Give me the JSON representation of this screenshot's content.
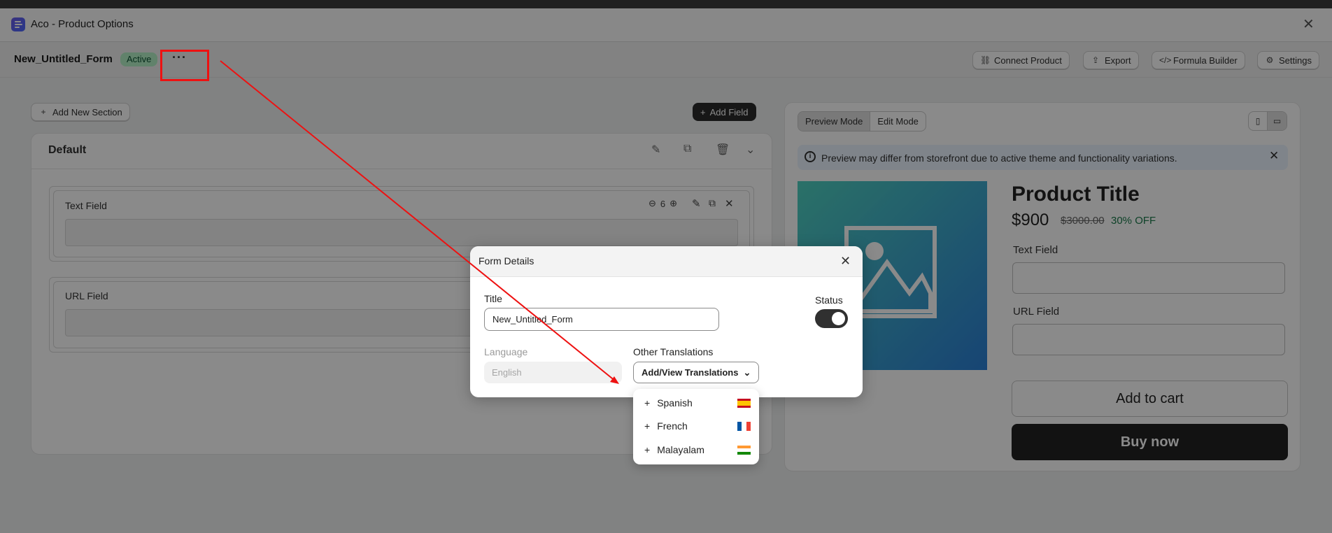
{
  "app": {
    "title": "Aco - Product Options"
  },
  "header": {
    "form_name": "New_Untitled_Form",
    "status_badge": "Active",
    "more_label": "···",
    "buttons": [
      {
        "label": "Connect Product",
        "icon": "link-icon"
      },
      {
        "label": "Export",
        "icon": "upload-icon"
      },
      {
        "label": "Formula Builder",
        "icon": "code-icon"
      },
      {
        "label": "Settings",
        "icon": "gear-icon"
      }
    ]
  },
  "builder": {
    "add_section_label": "Add New Section",
    "add_field_label": "Add Field",
    "section_title": "Default",
    "fields": [
      {
        "label": "Text Field",
        "width_value": "6"
      },
      {
        "label": "URL Field"
      }
    ]
  },
  "preview": {
    "modes": [
      "Preview Mode",
      "Edit Mode"
    ],
    "active_mode": "Preview Mode",
    "banner": "Preview may differ from storefront due to active theme and functionality variations.",
    "product_title": "Product Title",
    "price": "$900",
    "compare_price": "$3000.00",
    "discount": "30% OFF",
    "field_labels": [
      "Text Field",
      "URL Field"
    ],
    "add_to_cart": "Add to cart",
    "buy_now": "Buy now"
  },
  "modal": {
    "title": "Form Details",
    "title_label": "Title",
    "title_value": "New_Untitled_Form",
    "status_label": "Status",
    "status_on": true,
    "language_label": "Language",
    "language_value": "English",
    "other_translations_label": "Other Translations",
    "translations_button": "Add/View Translations",
    "translations": [
      {
        "label": "Spanish",
        "flag": "spain-flag-icon"
      },
      {
        "label": "French",
        "flag": "france-flag-icon"
      },
      {
        "label": "Malayalam",
        "flag": "india-flag-icon"
      }
    ]
  },
  "colors": {
    "accent": "#303030",
    "badge_bg": "#b4f0c6",
    "annotation": "#e11111"
  }
}
